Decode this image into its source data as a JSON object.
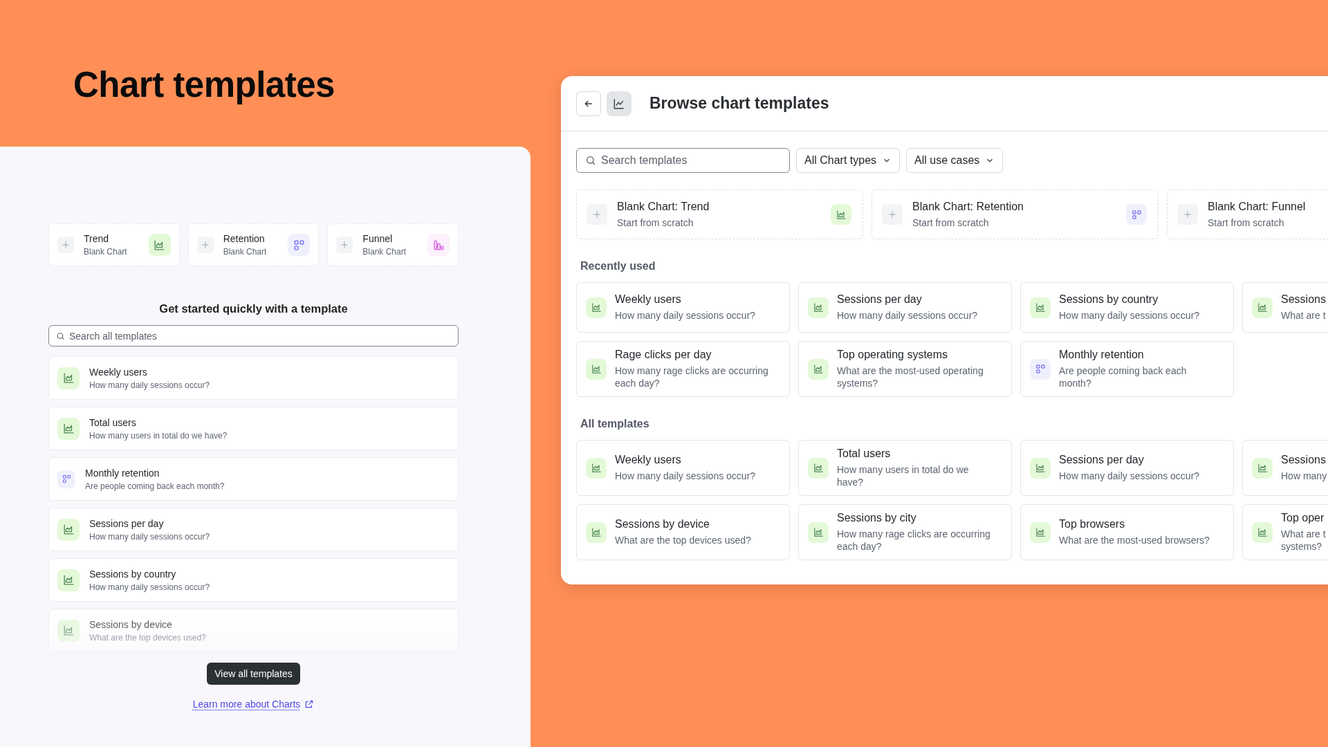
{
  "page_title": "Chart templates",
  "left": {
    "blank_charts": [
      {
        "title": "Trend",
        "subtitle": "Blank Chart",
        "kind": "trend"
      },
      {
        "title": "Retention",
        "subtitle": "Blank Chart",
        "kind": "retention"
      },
      {
        "title": "Funnel",
        "subtitle": "Blank Chart",
        "kind": "funnel"
      }
    ],
    "heading": "Get started quickly with a template",
    "search": {
      "placeholder": "Search all templates"
    },
    "templates": [
      {
        "title": "Weekly users",
        "description": "How many daily sessions occur?",
        "kind": "trend"
      },
      {
        "title": "Total users",
        "description": "How many users in total do we have?",
        "kind": "trend"
      },
      {
        "title": "Monthly retention",
        "description": "Are people coming back each month?",
        "kind": "retention"
      },
      {
        "title": "Sessions per day",
        "description": "How many daily sessions occur?",
        "kind": "trend"
      },
      {
        "title": "Sessions by country",
        "description": "How many daily sessions occur?",
        "kind": "trend"
      },
      {
        "title": "Sessions by device",
        "description": "What are the top devices used?",
        "kind": "trend"
      }
    ],
    "button": "View all templates",
    "link": "Learn more about Charts"
  },
  "right": {
    "title": "Browse chart templates",
    "search": {
      "placeholder": "Search templates"
    },
    "filters": [
      "All Chart types",
      "All use cases"
    ],
    "blank_charts": [
      {
        "title": "Blank Chart: Trend",
        "subtitle": "Start from scratch",
        "kind": "trend"
      },
      {
        "title": "Blank Chart: Retention",
        "subtitle": "Start from scratch",
        "kind": "retention"
      },
      {
        "title": "Blank Chart: Funnel",
        "subtitle": "Start from scratch"
      }
    ],
    "sections": [
      {
        "title": "Recently used",
        "templates": [
          {
            "title": "Weekly users",
            "description": "How many daily sessions occur?",
            "kind": "trend"
          },
          {
            "title": "Sessions per day",
            "description": "How many daily sessions occur?",
            "kind": "trend"
          },
          {
            "title": "Sessions by country",
            "description": "How many daily sessions occur?",
            "kind": "trend"
          },
          {
            "title": "Sessions",
            "description": "What are t",
            "kind": "trend"
          },
          {
            "title": "Rage clicks per day",
            "description": "How many rage clicks are occurring\neach day?",
            "kind": "trend"
          },
          {
            "title": "Top operating systems",
            "description": "What are the most-used operating\nsystems?",
            "kind": "trend"
          },
          {
            "title": "Monthly retention",
            "description": "Are people coming back each\nmonth?",
            "kind": "retention"
          }
        ]
      },
      {
        "title": "All templates",
        "templates": [
          {
            "title": "Weekly users",
            "description": "How many daily sessions occur?",
            "kind": "trend"
          },
          {
            "title": "Total users",
            "description": "How many users in total do we\nhave?",
            "kind": "trend"
          },
          {
            "title": "Sessions per day",
            "description": "How many daily sessions occur?",
            "kind": "trend"
          },
          {
            "title": "Sessions",
            "description": "How many",
            "kind": "trend"
          },
          {
            "title": "Sessions by device",
            "description": "What are the top devices used?",
            "kind": "trend"
          },
          {
            "title": "Sessions by city",
            "description": "How many rage clicks are occurring\neach day?",
            "kind": "trend"
          },
          {
            "title": "Top browsers",
            "description": "What are the most-used browsers?",
            "kind": "trend"
          },
          {
            "title": "Top oper",
            "description": "What are t\nsystems?",
            "kind": "trend"
          }
        ]
      }
    ]
  }
}
